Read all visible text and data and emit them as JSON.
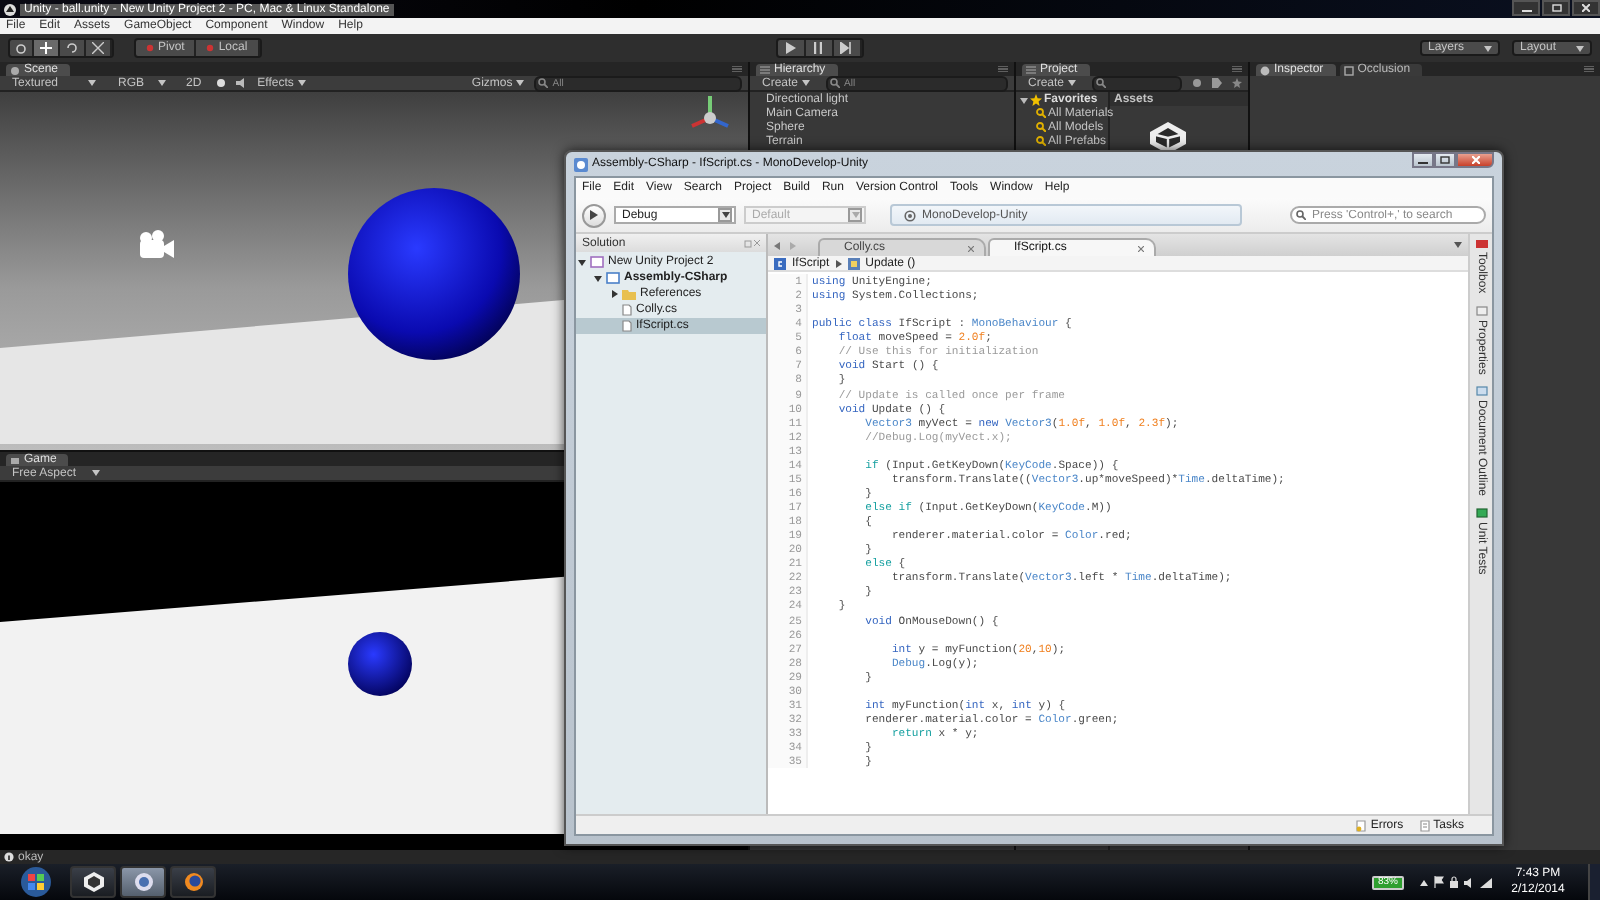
{
  "unity": {
    "title": "Unity - ball.unity - New Unity Project 2 - PC, Mac & Linux Standalone",
    "menu": [
      "File",
      "Edit",
      "Assets",
      "GameObject",
      "Component",
      "Window",
      "Help"
    ],
    "toolbar": {
      "pivot": "Pivot",
      "local": "Local",
      "layers": "Layers",
      "layout": "Layout"
    },
    "scene": {
      "tab": "Scene",
      "shading": "Textured",
      "channel": "RGB",
      "mode_2d": "2D",
      "effects": "Effects",
      "gizmos": "Gizmos",
      "search": {
        "placeholder": "All"
      }
    },
    "game": {
      "tab": "Game",
      "aspect": "Free Aspect"
    },
    "hierarchy": {
      "tab": "Hierarchy",
      "create": "Create",
      "search": {
        "placeholder": "All"
      },
      "items": [
        {
          "label": "Directional light",
          "selected": false
        },
        {
          "label": "Main Camera",
          "selected": false
        },
        {
          "label": "Sphere",
          "selected": false
        },
        {
          "label": "Terrain",
          "selected": false
        }
      ]
    },
    "project": {
      "tab": "Project",
      "create": "Create",
      "favorites": {
        "label": "Favorites",
        "expanded": true,
        "children": [
          "All Materials",
          "All Models",
          "All Prefabs"
        ]
      },
      "assets_header": "Assets"
    },
    "inspector": {
      "tabs": [
        {
          "label": "Inspector",
          "selected": true
        },
        {
          "label": "Occlusion",
          "selected": false
        }
      ]
    },
    "status_bar": "okay"
  },
  "monodevelop": {
    "title": "Assembly-CSharp - IfScript.cs - MonoDevelop-Unity",
    "menu": [
      "File",
      "Edit",
      "View",
      "Search",
      "Project",
      "Build",
      "Run",
      "Version Control",
      "Tools",
      "Window",
      "Help"
    ],
    "toolbar": {
      "configs": [
        {
          "label": "Debug",
          "disabled": false
        },
        {
          "label": "Default",
          "disabled": true
        }
      ],
      "status": "MonoDevelop-Unity",
      "search": {
        "placeholder": "Press 'Control+,' to search"
      }
    },
    "solution": {
      "header": "Solution",
      "tree": [
        {
          "label": "New Unity Project 2",
          "kind": "solution",
          "expanded": true,
          "selected": false,
          "children": [
            {
              "label": "Assembly-CSharp",
              "kind": "project",
              "expanded": true,
              "selected": false,
              "children": [
                {
                  "label": "References",
                  "kind": "folder",
                  "expanded": false,
                  "selected": false
                },
                {
                  "label": "Colly.cs",
                  "kind": "file",
                  "selected": false
                },
                {
                  "label": "IfScript.cs",
                  "kind": "file",
                  "selected": true
                }
              ]
            }
          ]
        }
      ]
    },
    "tabs": [
      {
        "label": "Colly.cs",
        "selected": false
      },
      {
        "label": "IfScript.cs",
        "selected": true
      }
    ],
    "breadcrumb": [
      "IfScript",
      "Update ()"
    ],
    "code": [
      {
        "number": "1",
        "tokens": [
          {
            "kind": "keyword",
            "text": "using"
          },
          {
            "kind": "plain",
            "text": " UnityEngine;"
          }
        ]
      },
      {
        "number": "2",
        "tokens": [
          {
            "kind": "keyword",
            "text": "using"
          },
          {
            "kind": "plain",
            "text": " System.Collections;"
          }
        ]
      },
      {
        "number": "3"
      },
      {
        "number": "4",
        "tokens": [
          {
            "kind": "keyword",
            "text": "public class"
          },
          {
            "kind": "plain",
            "text": " IfScript : "
          },
          {
            "kind": "type",
            "text": "MonoBehaviour"
          },
          {
            "kind": "plain",
            "text": " {"
          }
        ]
      },
      {
        "number": "5",
        "tokens": [
          {
            "kind": "keyword",
            "text": "    float"
          },
          {
            "kind": "plain",
            "text": " moveSpeed = "
          },
          {
            "kind": "number",
            "text": "2.0f"
          },
          {
            "kind": "plain",
            "text": ";"
          }
        ]
      },
      {
        "number": "6",
        "tokens": [
          {
            "kind": "comment",
            "text": "    // Use this for initialization"
          }
        ]
      },
      {
        "number": "7",
        "tokens": [
          {
            "kind": "keyword",
            "text": "    void"
          },
          {
            "kind": "plain",
            "text": " Start () {"
          }
        ]
      },
      {
        "number": "8",
        "tokens": [
          {
            "kind": "plain",
            "text": "    }"
          }
        ]
      },
      {
        "number": "9",
        "tokens": [
          {
            "kind": "comment",
            "text": "    // Update is called once per frame"
          }
        ]
      },
      {
        "number": "10",
        "tokens": [
          {
            "kind": "keyword",
            "text": "    void"
          },
          {
            "kind": "plain",
            "text": " Update () {"
          }
        ]
      },
      {
        "number": "11",
        "tokens": [
          {
            "kind": "type",
            "text": "        Vector3"
          },
          {
            "kind": "plain",
            "text": " myVect = "
          },
          {
            "kind": "keyword",
            "text": "new"
          },
          {
            "kind": "type",
            "text": " Vector3"
          },
          {
            "kind": "plain",
            "text": "("
          },
          {
            "kind": "number",
            "text": "1.0f"
          },
          {
            "kind": "plain",
            "text": ", "
          },
          {
            "kind": "number",
            "text": "1.0f"
          },
          {
            "kind": "plain",
            "text": ", "
          },
          {
            "kind": "number",
            "text": "2.3f"
          },
          {
            "kind": "plain",
            "text": ");"
          }
        ]
      },
      {
        "number": "12",
        "tokens": [
          {
            "kind": "comment",
            "text": "        //Debug.Log(myVect.x);"
          }
        ]
      },
      {
        "number": "13"
      },
      {
        "number": "14",
        "tokens": [
          {
            "kind": "control",
            "text": "        if"
          },
          {
            "kind": "plain",
            "text": " (Input.GetKeyDown("
          },
          {
            "kind": "type",
            "text": "KeyCode"
          },
          {
            "kind": "plain",
            "text": ".Space)) {"
          }
        ]
      },
      {
        "number": "15",
        "tokens": [
          {
            "kind": "plain",
            "text": "            transform.Translate(("
          },
          {
            "kind": "type",
            "text": "Vector3"
          },
          {
            "kind": "plain",
            "text": ".up*moveSpeed)*"
          },
          {
            "kind": "type",
            "text": "Time"
          },
          {
            "kind": "plain",
            "text": ".deltaTime);"
          }
        ]
      },
      {
        "number": "16",
        "tokens": [
          {
            "kind": "plain",
            "text": "        }"
          }
        ]
      },
      {
        "number": "17",
        "tokens": [
          {
            "kind": "control",
            "text": "        else if"
          },
          {
            "kind": "plain",
            "text": " (Input.GetKeyDown("
          },
          {
            "kind": "type",
            "text": "KeyCode"
          },
          {
            "kind": "plain",
            "text": ".M))"
          }
        ]
      },
      {
        "number": "18",
        "tokens": [
          {
            "kind": "plain",
            "text": "        {"
          }
        ]
      },
      {
        "number": "19",
        "tokens": [
          {
            "kind": "plain",
            "text": "            renderer.material.color = "
          },
          {
            "kind": "type",
            "text": "Color"
          },
          {
            "kind": "plain",
            "text": ".red;"
          }
        ]
      },
      {
        "number": "20",
        "tokens": [
          {
            "kind": "plain",
            "text": "        }"
          }
        ]
      },
      {
        "number": "21",
        "tokens": [
          {
            "kind": "control",
            "text": "        else"
          },
          {
            "kind": "plain",
            "text": " {"
          }
        ]
      },
      {
        "number": "22",
        "tokens": [
          {
            "kind": "plain",
            "text": "            transform.Translate("
          },
          {
            "kind": "type",
            "text": "Vector3"
          },
          {
            "kind": "plain",
            "text": ".left * "
          },
          {
            "kind": "type",
            "text": "Time"
          },
          {
            "kind": "plain",
            "text": ".deltaTime);"
          }
        ]
      },
      {
        "number": "23",
        "tokens": [
          {
            "kind": "plain",
            "text": "        }"
          }
        ]
      },
      {
        "number": "24",
        "tokens": [
          {
            "kind": "plain",
            "text": "    }"
          }
        ]
      },
      {
        "number": "25",
        "tokens": [
          {
            "kind": "keyword",
            "text": "        void"
          },
          {
            "kind": "plain",
            "text": " OnMouseDown() {"
          }
        ]
      },
      {
        "number": "26"
      },
      {
        "number": "27",
        "tokens": [
          {
            "kind": "keyword",
            "text": "            int"
          },
          {
            "kind": "plain",
            "text": " y = myFunction("
          },
          {
            "kind": "number",
            "text": "20"
          },
          {
            "kind": "plain",
            "text": ","
          },
          {
            "kind": "number",
            "text": "10"
          },
          {
            "kind": "plain",
            "text": ");"
          }
        ]
      },
      {
        "number": "28",
        "tokens": [
          {
            "kind": "type",
            "text": "            Debug"
          },
          {
            "kind": "plain",
            "text": ".Log(y);"
          }
        ]
      },
      {
        "number": "29",
        "tokens": [
          {
            "kind": "plain",
            "text": "        }"
          }
        ]
      },
      {
        "number": "30"
      },
      {
        "number": "31",
        "tokens": [
          {
            "kind": "keyword",
            "text": "        int"
          },
          {
            "kind": "plain",
            "text": " myFunction("
          },
          {
            "kind": "keyword",
            "text": "int"
          },
          {
            "kind": "plain",
            "text": " x, "
          },
          {
            "kind": "keyword",
            "text": "int"
          },
          {
            "kind": "plain",
            "text": " y) {"
          }
        ]
      },
      {
        "number": "32",
        "tokens": [
          {
            "kind": "plain",
            "text": "        renderer.material.color = "
          },
          {
            "kind": "type",
            "text": "Color"
          },
          {
            "kind": "plain",
            "text": ".green;"
          }
        ]
      },
      {
        "number": "33",
        "tokens": [
          {
            "kind": "control",
            "text": "            return"
          },
          {
            "kind": "plain",
            "text": " x * y;"
          }
        ]
      },
      {
        "number": "34",
        "tokens": [
          {
            "kind": "plain",
            "text": "        }"
          }
        ]
      },
      {
        "number": "35",
        "tokens": [
          {
            "kind": "plain",
            "text": "        }"
          }
        ]
      }
    ],
    "side_pads": [
      "Toolbox",
      "Properties",
      "Document Outline",
      "Unit Tests"
    ],
    "status_pads": [
      "Errors",
      "Tasks"
    ]
  },
  "taskbar": {
    "battery": "83%",
    "time": "7:43 PM",
    "date": "2/12/2014"
  }
}
